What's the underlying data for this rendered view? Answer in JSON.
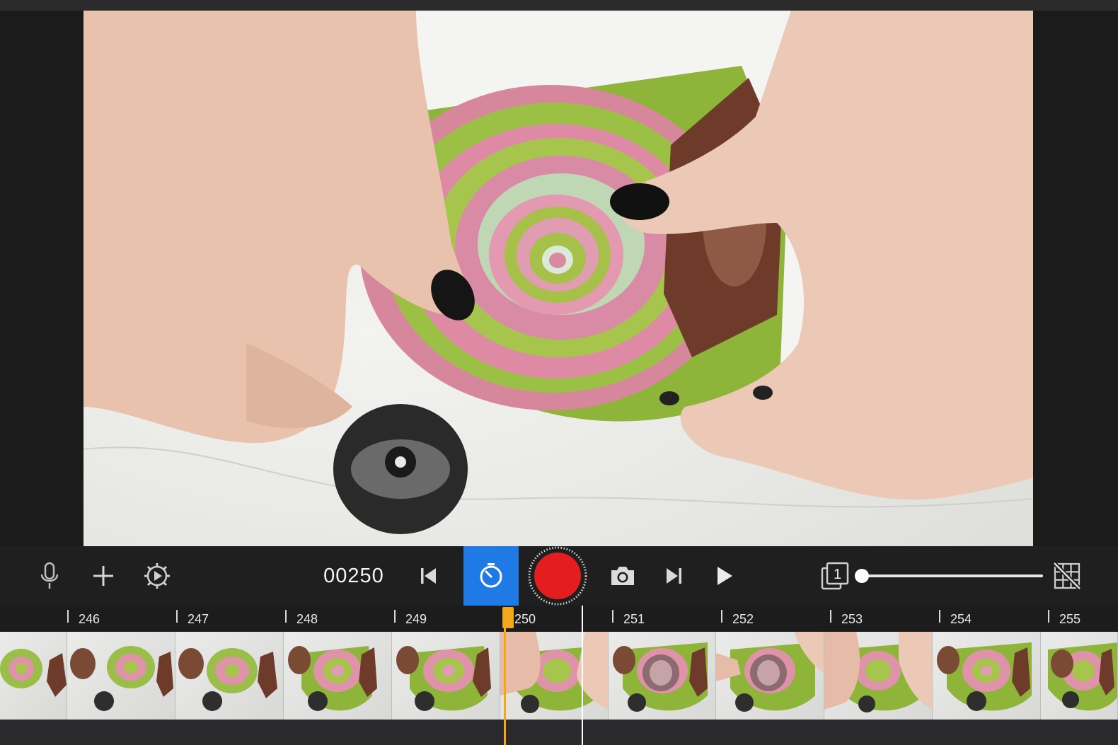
{
  "toolbar": {
    "frame_counter": "00250",
    "icons": {
      "microphone": "microphone-icon",
      "add": "plus-icon",
      "settings": "gear-play-icon",
      "first_frame": "skip-back-icon",
      "timer": "timer-icon",
      "record": "record-icon",
      "camera": "camera-icon",
      "last_frame": "skip-forward-icon",
      "play": "play-icon",
      "onion_skin": "onion-skin-frames-icon",
      "grid_off": "grid-off-icon"
    },
    "timer_active_color": "#1f7ae6",
    "record_color": "#e41e1e",
    "onion_skin_badge": "1",
    "onion_skin_level": 0.0
  },
  "timeline": {
    "frame_labels": [
      "246",
      "247",
      "248",
      "249",
      "250",
      "251",
      "252",
      "253",
      "254",
      "255"
    ],
    "current_frame": "250",
    "playhead_color": "#f2a81d"
  }
}
